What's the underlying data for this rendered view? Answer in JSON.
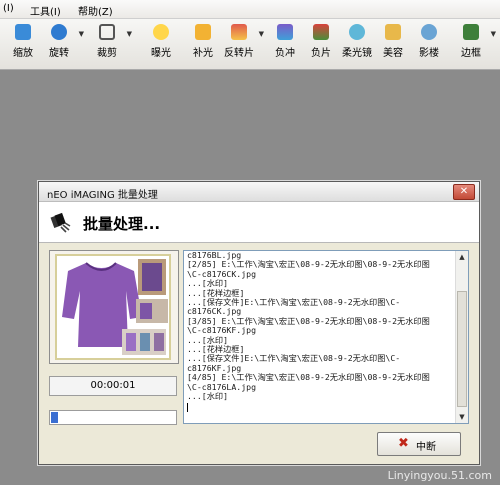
{
  "menu": [
    {
      "label": "(I)"
    },
    {
      "label": "工具(I)"
    },
    {
      "label": "帮助(Z)"
    }
  ],
  "toolbar": [
    {
      "label": "缩放",
      "icon": "zoom-icon",
      "color": "#3a8bd8",
      "dropdown": false
    },
    {
      "label": "旋转",
      "icon": "rotate-icon",
      "color": "#2f7bd0",
      "dropdown": true
    },
    {
      "label": "裁剪",
      "icon": "crop-icon",
      "color": "#555555",
      "dropdown": true
    },
    {
      "label": "曝光",
      "icon": "exposure-icon",
      "color": "#ffd64a",
      "dropdown": false
    },
    {
      "label": "补光",
      "icon": "fill-light-icon",
      "color": "#f2b233",
      "dropdown": false
    },
    {
      "label": "反转片",
      "icon": "reversal-film-icon",
      "color": "#e05a4c",
      "dropdown": true
    },
    {
      "label": "负冲",
      "icon": "cross-process-icon",
      "color": "#7a5cc8",
      "dropdown": false
    },
    {
      "label": "负片",
      "icon": "negative-icon",
      "color": "#d8423c",
      "dropdown": false
    },
    {
      "label": "柔光镜",
      "icon": "soft-focus-icon",
      "color": "#5fb7d8",
      "dropdown": false
    },
    {
      "label": "美容",
      "icon": "beauty-icon",
      "color": "#e8b84a",
      "dropdown": false
    },
    {
      "label": "影楼",
      "icon": "studio-icon",
      "color": "#6aa4d4",
      "dropdown": false
    },
    {
      "label": "边框",
      "icon": "border-icon",
      "color": "#3e7f3a",
      "dropdown": true
    }
  ],
  "dialog": {
    "title": "nEO iMAGING 批量处理",
    "close_label": "✕",
    "heading": "批量处理...",
    "elapsed": "00:00:01",
    "progress": 0.06,
    "stop_label": "中断",
    "log_lines": [
      "c8176BL.jpg",
      "[2/85] E:\\工作\\淘宝\\宏正\\08-9-2无水印图\\08-9-2无水印图",
      "\\C-c8176CK.jpg",
      "...[水印]",
      "...[花样边框]",
      "...[保存文件]E:\\工作\\淘宝\\宏正\\08-9-2无水印图\\C-",
      "c8176CK.jpg",
      "[3/85] E:\\工作\\淘宝\\宏正\\08-9-2无水印图\\08-9-2无水印图",
      "\\C-c8176KF.jpg",
      "...[水印]",
      "...[花样边框]",
      "...[保存文件]E:\\工作\\淘宝\\宏正\\08-9-2无水印图\\C-",
      "c8176KF.jpg",
      "[4/85] E:\\工作\\淘宝\\宏正\\08-9-2无水印图\\08-9-2无水印图",
      "\\C-c8176LA.jpg",
      "...[水印]"
    ]
  },
  "watermark": "Linyingyou.51.com"
}
